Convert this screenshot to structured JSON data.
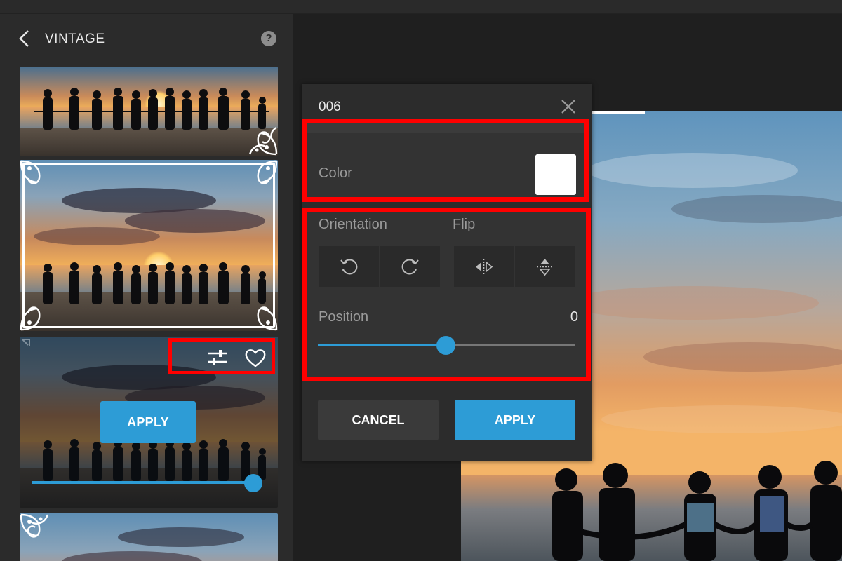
{
  "sidebar": {
    "title": "VINTAGE",
    "help_glyph": "?",
    "back_icon": "chevron-left-icon",
    "help_icon": "question-circle-icon"
  },
  "thumbnails": [
    {
      "id": "vintage-frame-1"
    },
    {
      "id": "vintage-frame-2"
    },
    {
      "id": "vintage-frame-3",
      "apply_label": "APPLY",
      "slider_percent": 100
    },
    {
      "id": "vintage-frame-4"
    }
  ],
  "panel": {
    "title": "006",
    "color_label": "Color",
    "color_value": "#ffffff",
    "orientation_label": "Orientation",
    "flip_label": "Flip",
    "position_label": "Position",
    "position_value": "0",
    "cancel_label": "CANCEL",
    "apply_label": "APPLY"
  },
  "colors": {
    "accent": "#2d9cd6",
    "highlight": "#ff0000",
    "panel_bg": "#2c2c2c"
  }
}
